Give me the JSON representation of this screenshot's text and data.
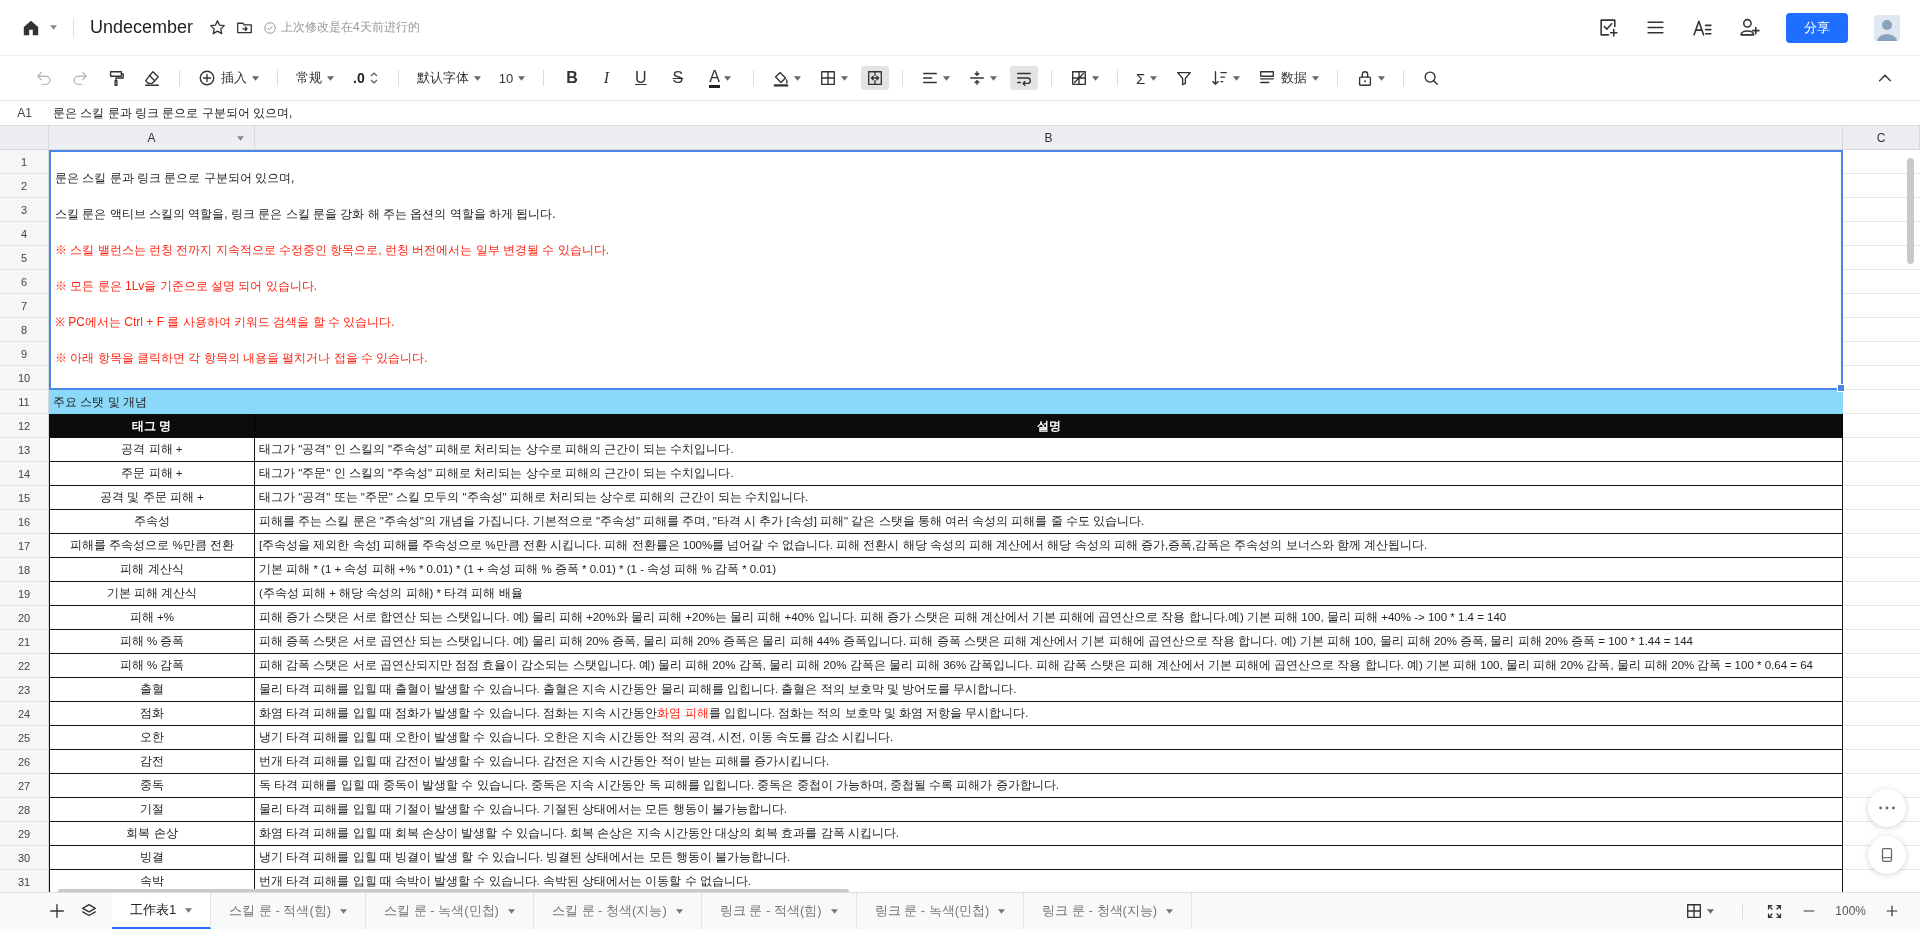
{
  "document": {
    "title": "Undecember",
    "status": "上次修改是在4天前进行的"
  },
  "share_button": "分享",
  "toolbar": {
    "undo_disabled": true,
    "redo_disabled": true,
    "insert": "插入",
    "number_format": "常规",
    "decimal": ".0",
    "font": "默认字体",
    "font_size": "10",
    "format_buttons": [
      {
        "label": "B",
        "kind": "bold"
      },
      {
        "label": "I",
        "kind": "italic"
      },
      {
        "label": "U",
        "kind": "underline"
      },
      {
        "label": "S",
        "kind": "strike"
      },
      {
        "label": "A",
        "kind": "color"
      }
    ],
    "merge_active": true,
    "wrap_active": true,
    "sum": "Σ",
    "data": "数据"
  },
  "formula_bar": {
    "cell": "A1",
    "content": "룬은 스킬 룬과 링크 룬으로 구분되어 있으며,"
  },
  "columns": [
    "A",
    "B",
    "C"
  ],
  "row_numbers": [
    "1",
    "2",
    "3",
    "4",
    "5",
    "6",
    "7",
    "8",
    "9",
    "10",
    "11",
    "12",
    "13",
    "14",
    "15",
    "16",
    "17",
    "18",
    "19",
    "20",
    "21",
    "22",
    "23",
    "24",
    "25",
    "26",
    "27",
    "28",
    "29",
    "30",
    "31"
  ],
  "intro": {
    "selected": true,
    "lines": [
      {
        "text": "룬은 스킬 룬과 링크 룬으로 구분되어 있으며,",
        "warning": false
      },
      {
        "text": "스킬 룬은 액티브 스킬의 역할을, 링크 룬은 스킬 룬을 강화 해 주는 옵션의 역할을 하게 됩니다.",
        "warning": false
      },
      {
        "text": "※ 스킬 밸런스는 런칭 전까지 지속적으로 수정중인 항목으로, 런칭 버전에서는 일부 변경될 수 있습니다.",
        "warning": true
      },
      {
        "text": "※ 모든 룬은 1Lv을 기준으로 설명 되어 있습니다.",
        "warning": true
      },
      {
        "text": "※ PC에서는 Ctrl + F 를 사용하여 키워드 검색을 할 수 있습니다.",
        "warning": true
      },
      {
        "text": "※ 아래 항목을 클릭하면 각 항목의 내용을 펼치거나 접을 수 있습니다.",
        "warning": true
      }
    ]
  },
  "section_title": "주요 스탯 및 개념",
  "table": {
    "columns": [
      "태그 명",
      "설명"
    ],
    "rows": [
      {
        "tag": "공격 피해 +",
        "description": [
          {
            "text": "태그가 \"공격\" 인 스킬의 \"주속성\" 피해로 처리되는 상수로 피해의 근간이 되는 수치입니다.",
            "highlight": false
          }
        ]
      },
      {
        "tag": "주문 피해 +",
        "description": [
          {
            "text": "태그가 \"주문\" 인 스킬의 \"주속성\" 피해로 처리되는 상수로 피해의 근간이 되는 수치입니다.",
            "highlight": false
          }
        ]
      },
      {
        "tag": "공격 및 주문 피해 +",
        "description": [
          {
            "text": "태그가 \"공격\" 또는 \"주문\" 스킬 모두의 \"주속성\" 피해로 처리되는 상수로 피해의 근간이 되는 수치입니다.",
            "highlight": false
          }
        ]
      },
      {
        "tag": "주속성",
        "description": [
          {
            "text": "피해를 주는 스킬 룬은 \"주속성\"의 개념을 가집니다. 기본적으로 \"주속성\" 피해를 주며, \"타격 시 추가 [속성] 피해\" 같은 스탯을 통해 여러 속성의 피해를 줄 수도 있습니다.",
            "highlight": false
          }
        ]
      },
      {
        "tag": "피해를 주속성으로 %만큼 전환",
        "description": [
          {
            "text": "[주속성을 제외한 속성] 피해를 주속성으로 %만큼 전환 시킵니다. 피해 전환률은 100%를 넘어갈 수 없습니다. 피해 전환시 해당 속성의 피해 계산에서 해당 속성의 피해 증가,증폭,감폭은 주속성의 보너스와 함께 계산됩니다.",
            "highlight": false
          }
        ]
      },
      {
        "tag": "피해 계산식",
        "description": [
          {
            "text": "기본 피해 * (1 + 속성 피해 +% * 0.01) * (1 + 속성 피해 % 증폭 * 0.01) * (1 - 속성 피해 % 감폭 * 0.01)",
            "highlight": false
          }
        ]
      },
      {
        "tag": "기본 피해 계산식",
        "description": [
          {
            "text": "(주속성 피해 + 해당 속성의 피해) * 타격 피해 배율",
            "highlight": false
          }
        ]
      },
      {
        "tag": "피해 +%",
        "description": [
          {
            "text": "피해 증가 스탯은 서로 합연산 되는 스탯입니다. 예) 물리 피해 +20%와 물리 피해 +20%는 물리 피해 +40% 입니다. 피해 증가 스탯은 피해 계산에서 기본 피해에 곱연산으로 작용 합니다.예) 기본 피해 100, 물리 피해 +40% -> 100 * 1.4 = 140",
            "highlight": false
          }
        ]
      },
      {
        "tag": "피해 % 증폭",
        "description": [
          {
            "text": "피해 증폭 스탯은 서로 곱연산 되는 스탯입니다. 예) 물리 피해 20% 증폭, 물리 피해 20% 증폭은 물리 피해 44% 증폭입니다. 피해 증폭 스탯은 피해 계산에서 기본 피해에 곱연산으로 작용 합니다. 예) 기본 피해 100, 물리 피해 20% 증폭, 물리 피해 20% 증폭 = 100 * 1.44 = 144",
            "highlight": false
          }
        ]
      },
      {
        "tag": "피해 % 감폭",
        "description": [
          {
            "text": "피해 감폭 스탯은 서로 곱연산되지만 점점 효율이 감소되는 스탯입니다. 예) 물리 피해 20% 감폭, 물리 피해 20% 감폭은 물리 피해 36% 감폭입니다. 피해 감폭 스탯은 피해 계산에서 기본 피해에 곱연산으로 작용 합니다. 예) 기본 피해 100, 물리 피해 20% 감폭, 물리 피해 20% 감폭 = 100 * 0.64 = 64",
            "highlight": false
          }
        ]
      },
      {
        "tag": "출혈",
        "description": [
          {
            "text": "물리 타격 피해를 입힐 때 출혈이 발생할 수 있습니다. 출혈은 지속 시간동안 물리 피해를 입힙니다. 출혈은 적의 보호막 및 방어도를 무시합니다.",
            "highlight": false
          }
        ]
      },
      {
        "tag": "점화",
        "description": [
          {
            "text": "화염 타격 피해를 입힐 때 점화가 발생할 수 있습니다. 점화는 지속 시간동안 ",
            "highlight": false
          },
          {
            "text": "화염 피해",
            "highlight": true
          },
          {
            "text": "를 입힙니다. 점화는 적의 보호막 및 화염 저항을 무시합니다.",
            "highlight": false
          }
        ]
      },
      {
        "tag": "오한",
        "description": [
          {
            "text": "냉기 타격 피해를 입힐 때 오한이 발생할 수 있습니다. 오한은 지속 시간동안 적의 공격, 시전, 이동 속도를 감소 시킵니다.",
            "highlight": false
          }
        ]
      },
      {
        "tag": "감전",
        "description": [
          {
            "text": "번개 타격 피해를 입힐 때 감전이 발생할 수 있습니다. 감전은 지속 시간동안 적이 받는 피해를 증가시킵니다.",
            "highlight": false
          }
        ]
      },
      {
        "tag": "중독",
        "description": [
          {
            "text": "독 타격 피해를 입힐 때 중독이 발생할 수 있습니다. 중독은 지속 시간동안 독 피해를 입힙니다. 중독은 중첩이 가능하며, 중첩될 수록 피해가 증가합니다.",
            "highlight": false
          }
        ]
      },
      {
        "tag": "기절",
        "description": [
          {
            "text": "물리 타격 피해를 입힐 때 기절이 발생할 수 있습니다. 기절된 상태에서는 모든 행동이 불가능합니다.",
            "highlight": false
          }
        ]
      },
      {
        "tag": "회복 손상",
        "description": [
          {
            "text": "화염 타격 피해를 입힐 때 회복 손상이 발생할 수 있습니다. 회복 손상은 지속 시간동안 대상의 회복 효과를 감폭 시킵니다.",
            "highlight": false
          }
        ]
      },
      {
        "tag": "빙결",
        "description": [
          {
            "text": "냉기 타격 피해를 입힐 때 빙결이 발생 할 수 있습니다. 빙결된 상태에서는 모든 행동이 불가능합니다.",
            "highlight": false
          }
        ]
      },
      {
        "tag": "속박",
        "description": [
          {
            "text": "번개 타격 피해를 입힐 때 속박이 발생할 수 있습니다. 속박된 상태에서는 이동할 수 없습니다.",
            "highlight": false
          }
        ]
      }
    ]
  },
  "sheet_tabs": [
    {
      "label": "工作表1",
      "selected": true
    },
    {
      "label": "스킬 룬 - 적색(힘)",
      "selected": false
    },
    {
      "label": "스킬 룬 - 녹색(민첩)",
      "selected": false
    },
    {
      "label": "스킬 룬 - 청색(지능)",
      "selected": false
    },
    {
      "label": "링크 룬 - 적색(힘)",
      "selected": false
    },
    {
      "label": "링크 룬 - 녹색(민첩)",
      "selected": false
    },
    {
      "label": "링크 룬 - 청색(지능)",
      "selected": false
    }
  ],
  "zoom": "100%"
}
